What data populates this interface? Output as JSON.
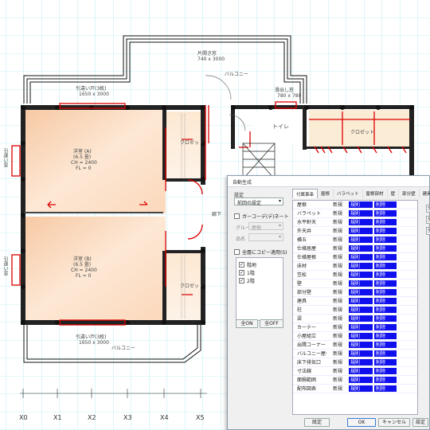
{
  "plan": {
    "balcony_top_room": "片開き窓",
    "balcony_top_dim": "740 x 3000",
    "balcony_label": "バルコニー",
    "window_top_left": "引違い戸(3枚)",
    "window_top_left_dim": "1650 x 3000",
    "window_top_right": "滑出し窓",
    "window_top_right_dim": "780 x 780",
    "room_a_name": "洋室 (A)",
    "room_a_area": "(6.5 畳)",
    "room_a_ch": "CH = 2400",
    "room_a_fl": "FL = 0",
    "room_b_name": "洋室 (B)",
    "room_b_area": "(6.5 畳)",
    "room_b_ch": "CH = 2400",
    "room_b_fl": "FL = 0",
    "closet_a": "クロゼット",
    "closet_b": "クロゼット",
    "closet_c": "クロゼット",
    "toilet": "トイレ",
    "hall": "廊下",
    "window_left_a": "引違い窓",
    "window_left_b": "引違い窓",
    "window_bottom": "引違い戸(3枚)",
    "window_bottom_dim": "1650 x 3000",
    "balcony_bottom": "バルコニー",
    "axes": [
      "X0",
      "X1",
      "X2",
      "X3",
      "X4",
      "X5"
    ]
  },
  "dialog": {
    "title": "自動生成",
    "section_label": "設定",
    "preset_value": "前回の設定",
    "group_checkbox_label": "ガーコーデ(デ)ネート",
    "group_label": "グループ",
    "group_value": "屋根",
    "kind_label": "品名",
    "apply_all_label": "全層にコピー適用(S)",
    "floors": [
      {
        "label": "階地",
        "checked": true
      },
      {
        "label": "1階",
        "checked": true
      },
      {
        "label": "2階",
        "checked": true
      }
    ],
    "all_on_label": "全ON",
    "all_off_label": "全OFF",
    "tabs": [
      "付属事串",
      "屋根",
      "バラペット",
      "屋根部材",
      "壁",
      "部分壁",
      "建具",
      "柱"
    ],
    "rows": [
      {
        "name": "屋根",
        "mode": "新規",
        "type": "規則",
        "opt": "削除"
      },
      {
        "name": "バラペット",
        "mode": "新規",
        "type": "規則",
        "opt": "削除"
      },
      {
        "name": "水平軒天",
        "mode": "新規",
        "type": "規則",
        "opt": "削除"
      },
      {
        "name": "外天井",
        "mode": "新規",
        "type": "規則",
        "opt": "削除"
      },
      {
        "name": "横五",
        "mode": "新規",
        "type": "規則",
        "opt": "削除"
      },
      {
        "name": "仕様居屋",
        "mode": "新規",
        "type": "規則",
        "opt": "削除"
      },
      {
        "name": "仕様屋根",
        "mode": "新規",
        "type": "規則",
        "opt": "削除"
      },
      {
        "name": "床材",
        "mode": "新規",
        "type": "規則",
        "opt": "削除"
      },
      {
        "name": "笠松",
        "mode": "新規",
        "type": "規則",
        "opt": "削除"
      },
      {
        "name": "壁",
        "mode": "新規",
        "type": "規則",
        "opt": "削除"
      },
      {
        "name": "部分壁",
        "mode": "新規",
        "type": "規則",
        "opt": "削除"
      },
      {
        "name": "建具",
        "mode": "新規",
        "type": "規則",
        "opt": "削除"
      },
      {
        "name": "柱",
        "mode": "新規",
        "type": "規則",
        "opt": "削除"
      },
      {
        "name": "梁",
        "mode": "新規",
        "type": "規則",
        "opt": "削除"
      },
      {
        "name": "カーテー",
        "mode": "新規",
        "type": "規則",
        "opt": "削除"
      },
      {
        "name": "小屋組立",
        "mode": "新規",
        "type": "規則",
        "opt": "削除"
      },
      {
        "name": "出隅コーナー",
        "mode": "新規",
        "type": "規則",
        "opt": "削除"
      },
      {
        "name": "バルコニー屋根子",
        "mode": "新規",
        "type": "規則",
        "opt": "削除"
      },
      {
        "name": "床下排気口",
        "mode": "新規",
        "type": "規則",
        "opt": "削除"
      },
      {
        "name": "寸法線",
        "mode": "新規",
        "type": "規則",
        "opt": "削除"
      },
      {
        "name": "面積範囲",
        "mode": "新規",
        "type": "規則",
        "opt": "削除"
      },
      {
        "name": "配布図表",
        "mode": "新規",
        "type": "規則",
        "opt": "削除"
      }
    ],
    "side_buttons": [
      "全",
      "全",
      "全"
    ],
    "footer_buttons": [
      "既定",
      "OK",
      "キャンセル",
      "設定"
    ]
  }
}
